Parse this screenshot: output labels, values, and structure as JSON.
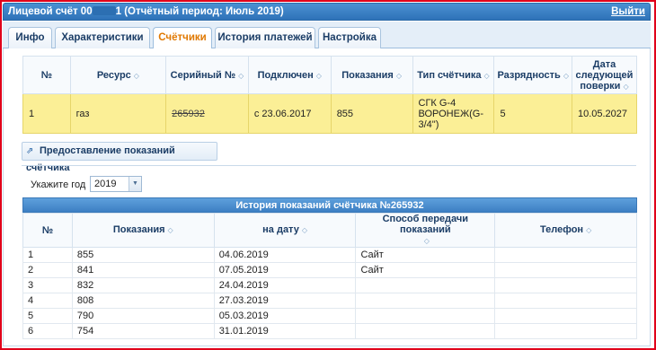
{
  "window": {
    "title_prefix": "Лицевой счёт 00",
    "title_suffix": "1 (Отчётный период: Июль 2019)",
    "exit_label": "Выйти"
  },
  "tabs": [
    {
      "label": "Инфо",
      "active": false
    },
    {
      "label": "Характеристики",
      "active": false
    },
    {
      "label": "Счётчики",
      "active": true
    },
    {
      "label": "История платежей",
      "active": false
    },
    {
      "label": "Настройка",
      "active": false
    }
  ],
  "meter_table": {
    "headers": [
      "№",
      "Ресурс",
      "Серийный №",
      "Подключен",
      "Показания",
      "Тип счётчика",
      "Разрядность",
      "Дата следующей поверки"
    ],
    "row": {
      "num": "1",
      "resource": "газ",
      "serial": "265932",
      "connected": "с 23.06.2017",
      "reading": "855",
      "type": "СГК G-4 ВОРОНЕЖ(G-3/4\")",
      "digits": "5",
      "next_check": "10.05.2027"
    }
  },
  "submit_button": {
    "label": "Предоставление показаний счётчика",
    "icon": "external-link-icon"
  },
  "year_filter": {
    "label": "Укажите год",
    "value": "2019"
  },
  "history": {
    "caption": "История показаний счётчика №265932",
    "headers": [
      "№",
      "Показания",
      "на дату",
      "Способ передачи показаний",
      "Телефон"
    ],
    "rows": [
      {
        "num": "1",
        "reading": "855",
        "date": "04.06.2019",
        "method": "Сайт",
        "phone": ""
      },
      {
        "num": "2",
        "reading": "841",
        "date": "07.05.2019",
        "method": "Сайт",
        "phone": ""
      },
      {
        "num": "3",
        "reading": "832",
        "date": "24.04.2019",
        "method": "",
        "phone": ""
      },
      {
        "num": "4",
        "reading": "808",
        "date": "27.03.2019",
        "method": "",
        "phone": ""
      },
      {
        "num": "5",
        "reading": "790",
        "date": "05.03.2019",
        "method": "",
        "phone": ""
      },
      {
        "num": "6",
        "reading": "754",
        "date": "31.01.2019",
        "method": "",
        "phone": ""
      }
    ]
  },
  "colors": {
    "accent": "#2e72b8",
    "highlight_row": "#fbef96",
    "active_tab_text": "#e07800",
    "frame": "#e0001a"
  }
}
